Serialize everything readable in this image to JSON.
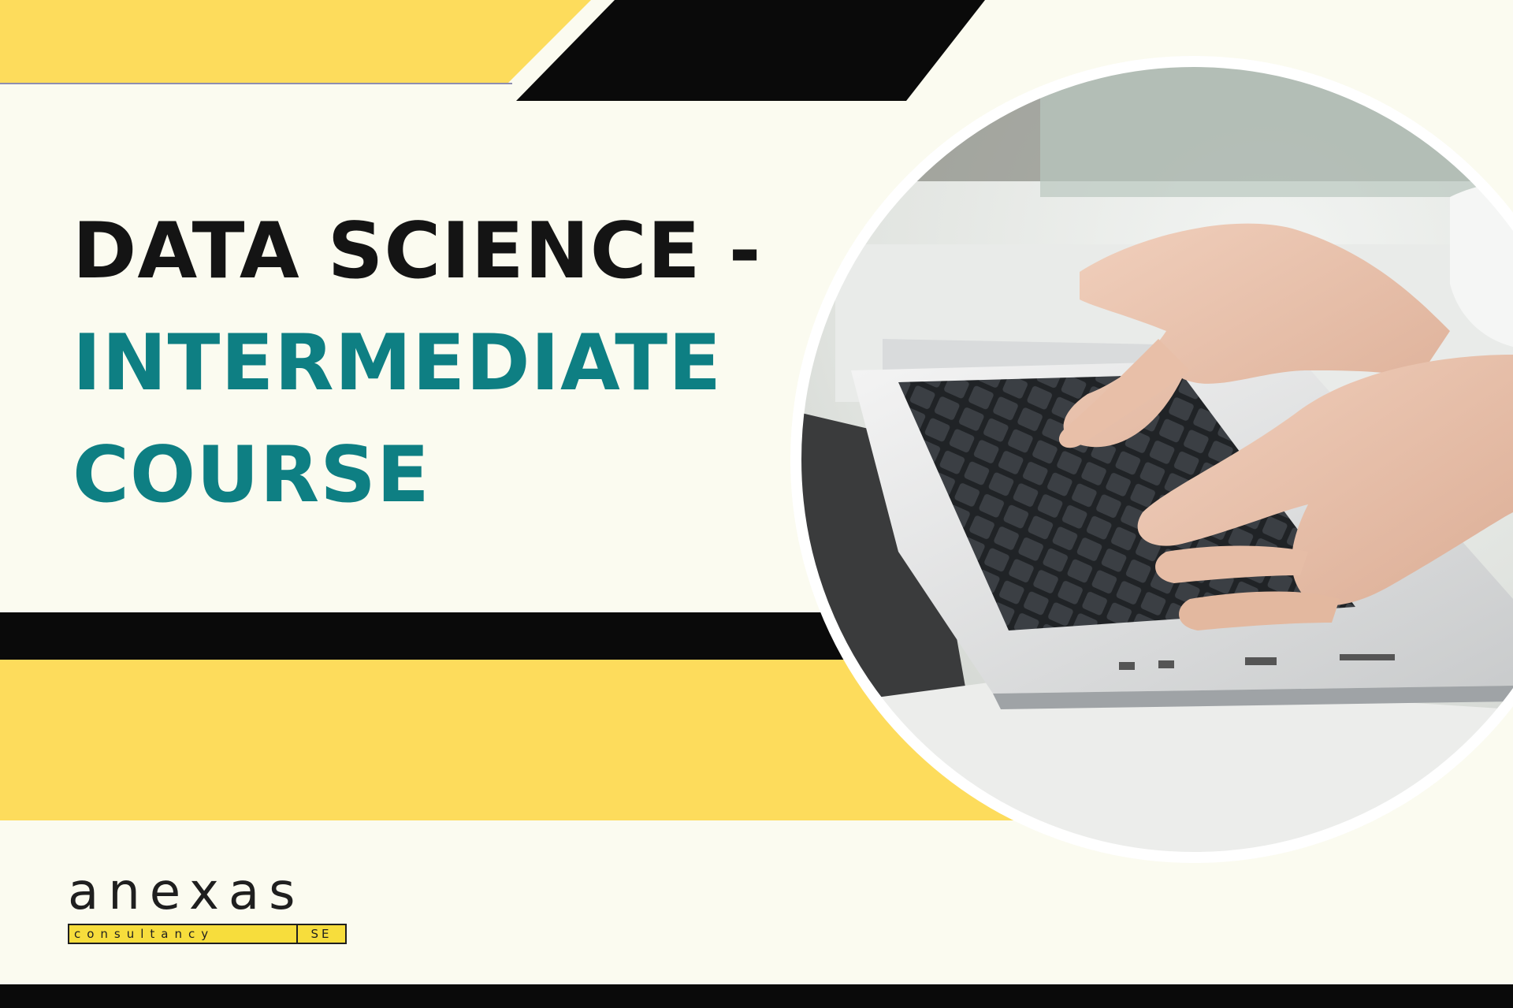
{
  "title": {
    "line1": "DATA SCIENCE -",
    "line2": "INTERMEDIATE",
    "line3": "COURSE"
  },
  "logo": {
    "name": "anexas",
    "subtitle": "consultancy",
    "suffix": "SE"
  },
  "photo": {
    "icon": "laptop-typing-photo"
  },
  "colors": {
    "background": "#fbfbf0",
    "yellow": "#fddc5c",
    "black": "#0a0a0a",
    "teal": "#0e7f83"
  }
}
